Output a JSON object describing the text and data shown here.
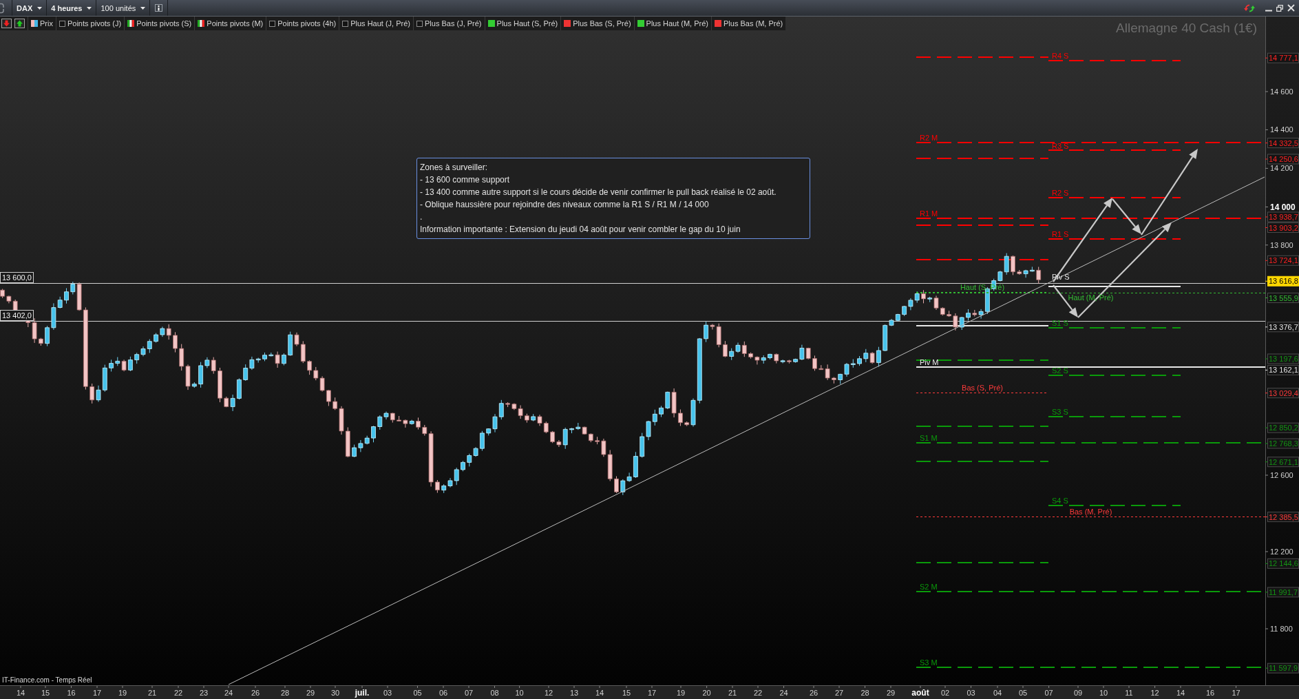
{
  "toolbar": {
    "symbol": "DAX",
    "timeframe": "4 heures",
    "quantity": "100 unités"
  },
  "legend": [
    {
      "label": "Prix",
      "on": true,
      "kind": "candles"
    },
    {
      "label": "Points pivots (J)",
      "on": false
    },
    {
      "label": "Points pivots (S)",
      "on": true,
      "kind": "pivots"
    },
    {
      "label": "Points pivots (M)",
      "on": true,
      "kind": "pivots"
    },
    {
      "label": "Points pivots (4h)",
      "on": false
    },
    {
      "label": "Plus Haut (J, Pré)",
      "on": false
    },
    {
      "label": "Plus Bas (J, Pré)",
      "on": false
    },
    {
      "label": "Plus Haut (S, Pré)",
      "on": true,
      "kind": "solid",
      "color": "#33cc33"
    },
    {
      "label": "Plus Bas (S, Pré)",
      "on": true,
      "kind": "solid",
      "color": "#ee3333"
    },
    {
      "label": "Plus Haut (M, Pré)",
      "on": true,
      "kind": "solid",
      "color": "#33cc33"
    },
    {
      "label": "Plus Bas (M, Pré)",
      "on": true,
      "kind": "solid",
      "color": "#ee3333"
    }
  ],
  "chart": {
    "title": "Allemagne 40 Cash (1€)",
    "note": [
      "Zones à surveiller:",
      "- 13 600 comme support",
      "- 13 400 comme autre support si le cours décide de venir confirmer le pull back réalisé le 02 août.",
      "- Oblique haussière pour rejoindre des niveaux comme la R1 S / R1 M / 14 000",
      ".",
      "Information importante : Extension du jeudi 04 août pour venir combler le gap du 10 juin"
    ],
    "source": "IT-Finance.com - Temps Réel",
    "reference_lines": [
      {
        "label": "13 600,0"
      },
      {
        "label": "13 402,0"
      }
    ],
    "levels": [
      {
        "color": "#ff0000",
        "kind": "previous_week"
      },
      {
        "label": "R4 S",
        "color": "#ff0000",
        "kind": "week"
      },
      {
        "label": "R2 M",
        "color": "#ff0000",
        "kind": "month"
      },
      {
        "label": "R3 S",
        "color": "#ff0000",
        "kind": "week"
      },
      {
        "color": "#ff0000",
        "kind": "previous_week"
      },
      {
        "label": "R2 S",
        "color": "#ff0000",
        "kind": "week"
      },
      {
        "label": "R1 M",
        "color": "#ff0000",
        "kind": "month"
      },
      {
        "color": "#ff0000",
        "kind": "previous_week"
      },
      {
        "label": "R1 S",
        "color": "#ff0000",
        "kind": "week"
      },
      {
        "color": "#ff0000",
        "kind": "previous_week"
      },
      {
        "label": "Piv S",
        "color": "#e8e8e8",
        "kind": "week_pivot"
      },
      {
        "label": "Haut (S, Pré)",
        "color": "#33bb33",
        "kind": "week_extreme"
      },
      {
        "label": "Haut (M, Pré)",
        "color": "#33bb33",
        "kind": "month_extreme"
      },
      {
        "color": "#e8e8e8",
        "kind": "previous_week_pivot"
      },
      {
        "label": "S1 S",
        "color": "#0a9a0a",
        "kind": "week"
      },
      {
        "color": "#0a9a0a",
        "kind": "previous_week"
      },
      {
        "label": "Piv M",
        "color": "#e8e8e8",
        "kind": "month_pivot"
      },
      {
        "label": "S2 S",
        "color": "#0a9a0a",
        "kind": "week"
      },
      {
        "label": "Bas (S, Pré)",
        "color": "#ff3b3b",
        "kind": "week_extreme"
      },
      {
        "label": "S3 S",
        "color": "#0a9a0a",
        "kind": "week"
      },
      {
        "color": "#0a9a0a",
        "kind": "previous_week"
      },
      {
        "label": "S1 M",
        "color": "#0a9a0a",
        "kind": "month"
      },
      {
        "color": "#0a9a0a",
        "kind": "previous_week"
      },
      {
        "label": "S4 S",
        "color": "#0a9a0a",
        "kind": "week"
      },
      {
        "label": "Bas (M, Pré)",
        "color": "#ff3b3b",
        "kind": "month_extreme"
      },
      {
        "color": "#0a9a0a",
        "kind": "previous_week"
      },
      {
        "label": "S2 M",
        "color": "#0a9a0a",
        "kind": "month"
      },
      {
        "label": "S3 M",
        "color": "#0a9a0a",
        "kind": "month"
      }
    ],
    "price_ticks": [
      {
        "label": "14 600",
        "kind": "minor"
      },
      {
        "label": "14 400",
        "kind": "minor"
      },
      {
        "label": "14 200",
        "kind": "minor"
      },
      {
        "label": "14 000",
        "kind": "major"
      },
      {
        "label": "13 800",
        "kind": "minor"
      },
      {
        "label": "12 600",
        "kind": "minor"
      },
      {
        "label": "12 200",
        "kind": "minor"
      },
      {
        "label": "11 800",
        "kind": "minor"
      }
    ],
    "price_tags": [
      {
        "text": "14 777,1",
        "kind": "level",
        "color": "#ff2222"
      },
      {
        "text": "14 332,5",
        "kind": "level",
        "color": "#ff2222"
      },
      {
        "text": "14 250,6",
        "kind": "level",
        "color": "#ff2222"
      },
      {
        "text": "13 938,7",
        "kind": "level",
        "color": "#ff2222"
      },
      {
        "text": "13 903,2",
        "kind": "level",
        "color": "#ff2222"
      },
      {
        "text": "13 724,1",
        "kind": "level",
        "color": "#ff2222"
      },
      {
        "text": "13 616,8",
        "kind": "current",
        "color": "#ffd700"
      },
      {
        "text": "13 555,9",
        "kind": "level",
        "color": "#33bb33"
      },
      {
        "text": "13 376,7",
        "kind": "level",
        "color": "#e6e6e6"
      },
      {
        "text": "13 197,6",
        "kind": "level",
        "color": "#149414"
      },
      {
        "text": "13 162,1",
        "kind": "level",
        "color": "#e6e6e6"
      },
      {
        "text": "13 029,4",
        "kind": "level",
        "color": "#ff3b3b"
      },
      {
        "text": "12 850,2",
        "kind": "level",
        "color": "#149414"
      },
      {
        "text": "12 768,3",
        "kind": "level",
        "color": "#149414"
      },
      {
        "text": "12 671,1",
        "kind": "level",
        "color": "#149414"
      },
      {
        "text": "12 385,5",
        "kind": "level",
        "color": "#ff3b3b"
      },
      {
        "text": "12 144,6",
        "kind": "level",
        "color": "#149414"
      },
      {
        "text": "11 991,7",
        "kind": "level",
        "color": "#149414"
      },
      {
        "text": "11 597,9",
        "kind": "level",
        "color": "#149414"
      }
    ],
    "dates": [
      {
        "label": "14",
        "kind": "day"
      },
      {
        "label": "15",
        "kind": "day"
      },
      {
        "label": "16",
        "kind": "day"
      },
      {
        "label": "17",
        "kind": "day"
      },
      {
        "label": "19",
        "kind": "day"
      },
      {
        "label": "21",
        "kind": "day"
      },
      {
        "label": "22",
        "kind": "day"
      },
      {
        "label": "23",
        "kind": "day"
      },
      {
        "label": "24",
        "kind": "day"
      },
      {
        "label": "26",
        "kind": "day"
      },
      {
        "label": "28",
        "kind": "day"
      },
      {
        "label": "29",
        "kind": "day"
      },
      {
        "label": "30",
        "kind": "day"
      },
      {
        "label": "juil.",
        "kind": "month"
      },
      {
        "label": "03",
        "kind": "day"
      },
      {
        "label": "05",
        "kind": "day"
      },
      {
        "label": "06",
        "kind": "day"
      },
      {
        "label": "07",
        "kind": "day"
      },
      {
        "label": "08",
        "kind": "day"
      },
      {
        "label": "10",
        "kind": "day"
      },
      {
        "label": "12",
        "kind": "day"
      },
      {
        "label": "13",
        "kind": "day"
      },
      {
        "label": "14",
        "kind": "day"
      },
      {
        "label": "15",
        "kind": "day"
      },
      {
        "label": "17",
        "kind": "day"
      },
      {
        "label": "19",
        "kind": "day"
      },
      {
        "label": "20",
        "kind": "day"
      },
      {
        "label": "21",
        "kind": "day"
      },
      {
        "label": "22",
        "kind": "day"
      },
      {
        "label": "24",
        "kind": "day"
      },
      {
        "label": "26",
        "kind": "day"
      },
      {
        "label": "27",
        "kind": "day"
      },
      {
        "label": "28",
        "kind": "day"
      },
      {
        "label": "29",
        "kind": "day"
      },
      {
        "label": "août",
        "kind": "month"
      },
      {
        "label": "02",
        "kind": "day"
      },
      {
        "label": "03",
        "kind": "day"
      },
      {
        "label": "04",
        "kind": "day"
      },
      {
        "label": "05",
        "kind": "day"
      },
      {
        "label": "07",
        "kind": "day"
      },
      {
        "label": "09",
        "kind": "day"
      },
      {
        "label": "10",
        "kind": "day"
      },
      {
        "label": "11",
        "kind": "day"
      },
      {
        "label": "12",
        "kind": "day"
      },
      {
        "label": "14",
        "kind": "day"
      },
      {
        "label": "16",
        "kind": "day"
      },
      {
        "label": "17",
        "kind": "day"
      }
    ]
  }
}
